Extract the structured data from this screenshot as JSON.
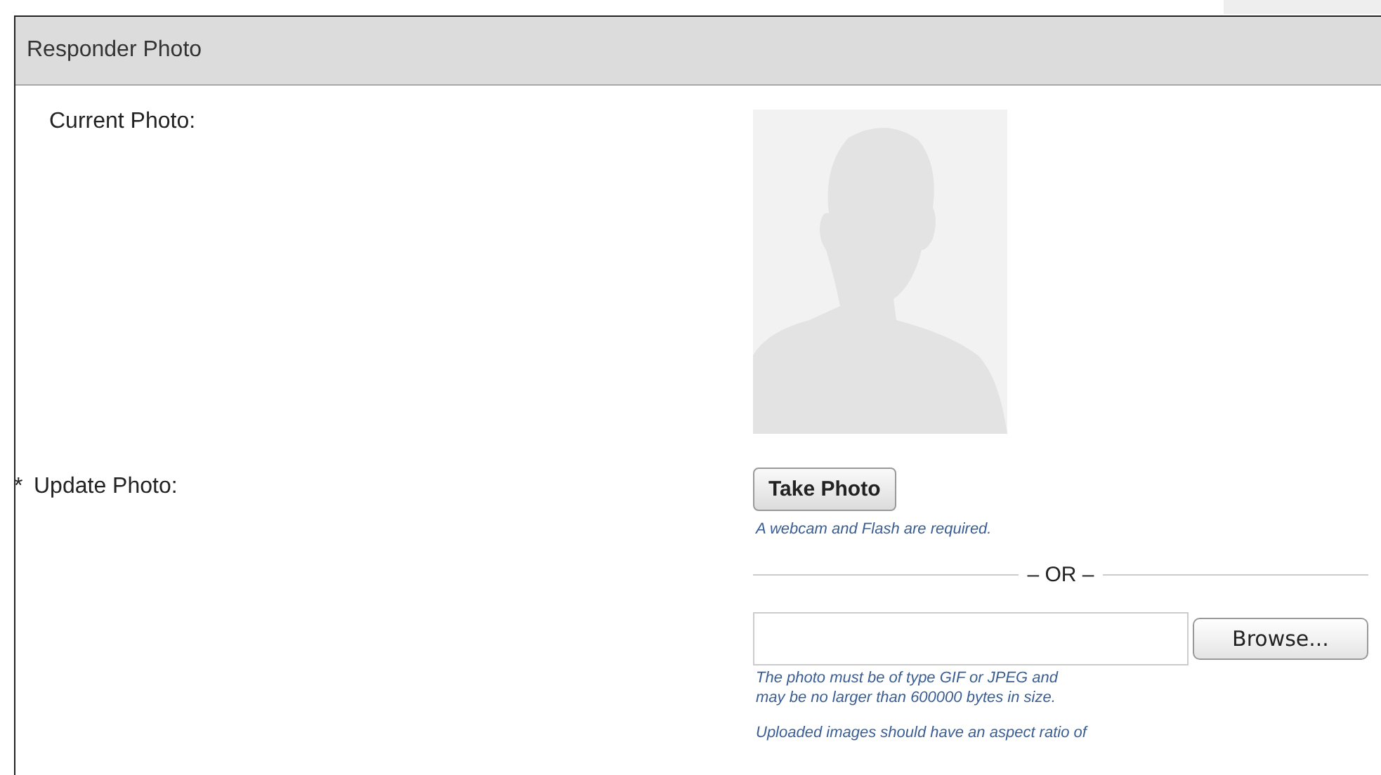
{
  "panel": {
    "title": "Responder Photo"
  },
  "current_photo": {
    "label": "Current Photo:"
  },
  "update_photo": {
    "required_mark": "*",
    "label": "Update Photo:",
    "take_photo_button": "Take Photo",
    "webcam_note": "A webcam and Flash are required.",
    "separator": "– OR –",
    "browse_button": "Browse...",
    "file_note": [
      "The photo must be of type GIF or JPEG and",
      "may be no larger than 600000 bytes in size."
    ],
    "aspect_note": "Uploaded images should have an aspect ratio of"
  }
}
